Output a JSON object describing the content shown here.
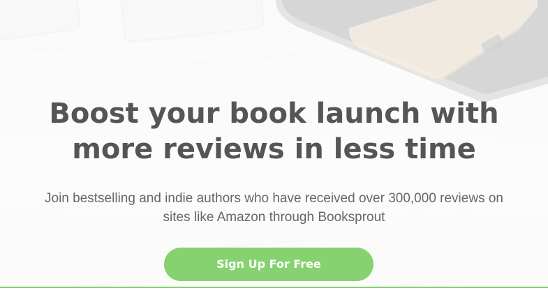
{
  "hero": {
    "headline": "Boost your book launch with more reviews in less time",
    "subhead": "Join bestselling and indie authors who have received over 300,000 reviews on sites like Amazon through Booksprout",
    "cta_label": "Sign Up For Free"
  },
  "colors": {
    "accent": "#86d271",
    "headline": "#555555",
    "body_text": "#666666"
  }
}
